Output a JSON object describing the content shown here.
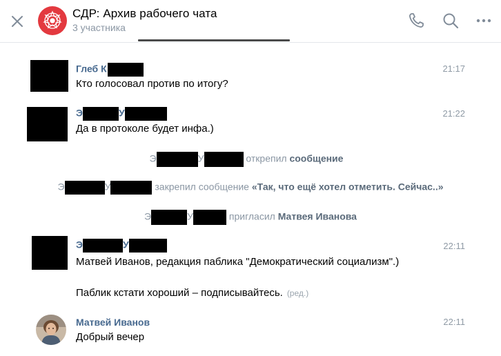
{
  "header": {
    "title": "СДР: Архив рабочего чата",
    "subtitle": "3 участника",
    "icons": [
      "close-icon",
      "phone-icon",
      "search-icon",
      "more-icon"
    ],
    "logo_color": "#e3393f"
  },
  "messages": [
    {
      "author": "Глеб К",
      "time": "21:17",
      "text": "Кто голосовал против по итогу?"
    },
    {
      "author_parts": [
        "Э",
        "У"
      ],
      "time": "21:22",
      "text": "Да в протоколе будет инфа.)"
    },
    {
      "author_parts": [
        "Э",
        "У"
      ],
      "time": "22:11",
      "text": "Матвей Иванов, редакция паблика \"Демократический социализм\".)",
      "text2": "Паблик кстати хороший – подписывайтесь.",
      "edited": "(ред.)"
    },
    {
      "author": "Матвей Иванов",
      "time": "22:11",
      "text": "Добрый вечер"
    }
  ],
  "service": [
    {
      "prefix": "Э",
      "mid": "У",
      "action": "открепил",
      "target": "сообщение"
    },
    {
      "prefix": "Э",
      "mid": "У",
      "action": "закрепил сообщение",
      "target": "«Так, что ещё хотел отметить. Сейчас..»"
    },
    {
      "prefix": "Э",
      "mid": "У",
      "action": "пригласил",
      "target": "Матвея Иванова"
    }
  ],
  "colors": {
    "author": "#47698f",
    "muted": "#8a96a3",
    "accent": "#e3393f"
  }
}
